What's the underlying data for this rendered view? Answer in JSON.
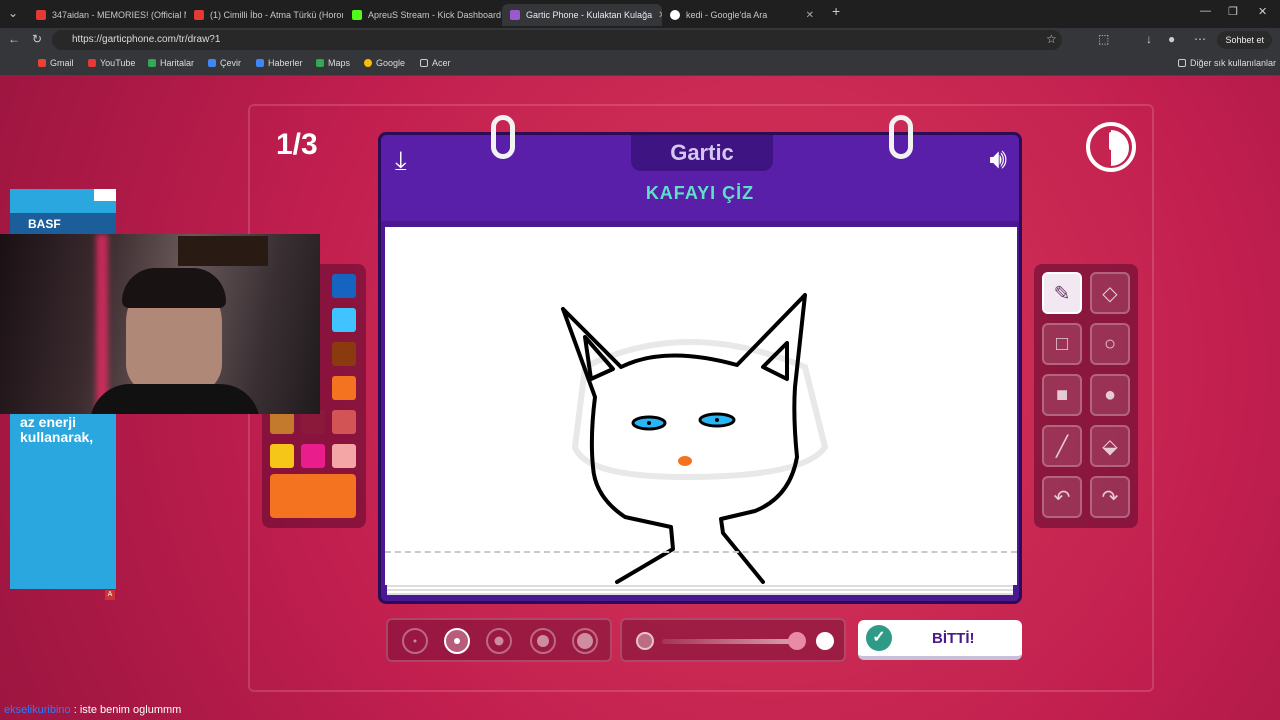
{
  "browser": {
    "tabs": [
      {
        "title": "347aidan - MEMORIES! (Official M",
        "icon_color": "#e53935"
      },
      {
        "title": "(1) Cimilli İbo - Atma Türkü (Horoı",
        "icon_color": "#e53935"
      },
      {
        "title": "ApreuS Stream - Kick Dashboard",
        "icon_color": "#53fc18"
      },
      {
        "title": "Gartic Phone - Kulaktan Kulağa",
        "icon_color": "#9b59d0"
      },
      {
        "title": "kedi - Google'da Ara",
        "icon_color": "#ffffff"
      }
    ],
    "url": "https://garticphone.com/tr/draw?1",
    "bookmarks": [
      "Gmail",
      "YouTube",
      "Haritalar",
      "Çevir",
      "Haberler",
      "Maps",
      "Google",
      "Acer"
    ],
    "other_bookmarks": "Diğer sık kullanılanlar",
    "chat_button": "Sohbet et"
  },
  "game": {
    "round": "1/3",
    "logo": "Gartic",
    "task": "KAFAYI ÇİZ",
    "done_label": "BİTTİ!",
    "selected_color": "#f37321",
    "colors": [
      "#1565c0",
      "#40c4ff",
      "#8b3a0f",
      "#f37321",
      "#b03a2e",
      "#c0392b",
      "#d35454",
      "#c47a2c",
      "#8b1a3a",
      "#f5c518",
      "#e91e8c",
      "#f4a6a6"
    ],
    "tools": [
      "pencil-icon",
      "eraser-icon",
      "rect-outline-icon",
      "circle-outline-icon",
      "rect-fill-icon",
      "circle-fill-icon",
      "line-icon",
      "fill-bucket-icon",
      "undo-icon",
      "redo-icon"
    ],
    "selected_tool": "pencil-icon",
    "brush_sizes_count": 5,
    "selected_brush_size": 2
  },
  "overlay": {
    "ad_brand": "BASF",
    "ad_text": "az enerji kullanarak,",
    "chat_user": "ekselikuribino",
    "chat_message": ": iste benim oglummm"
  }
}
